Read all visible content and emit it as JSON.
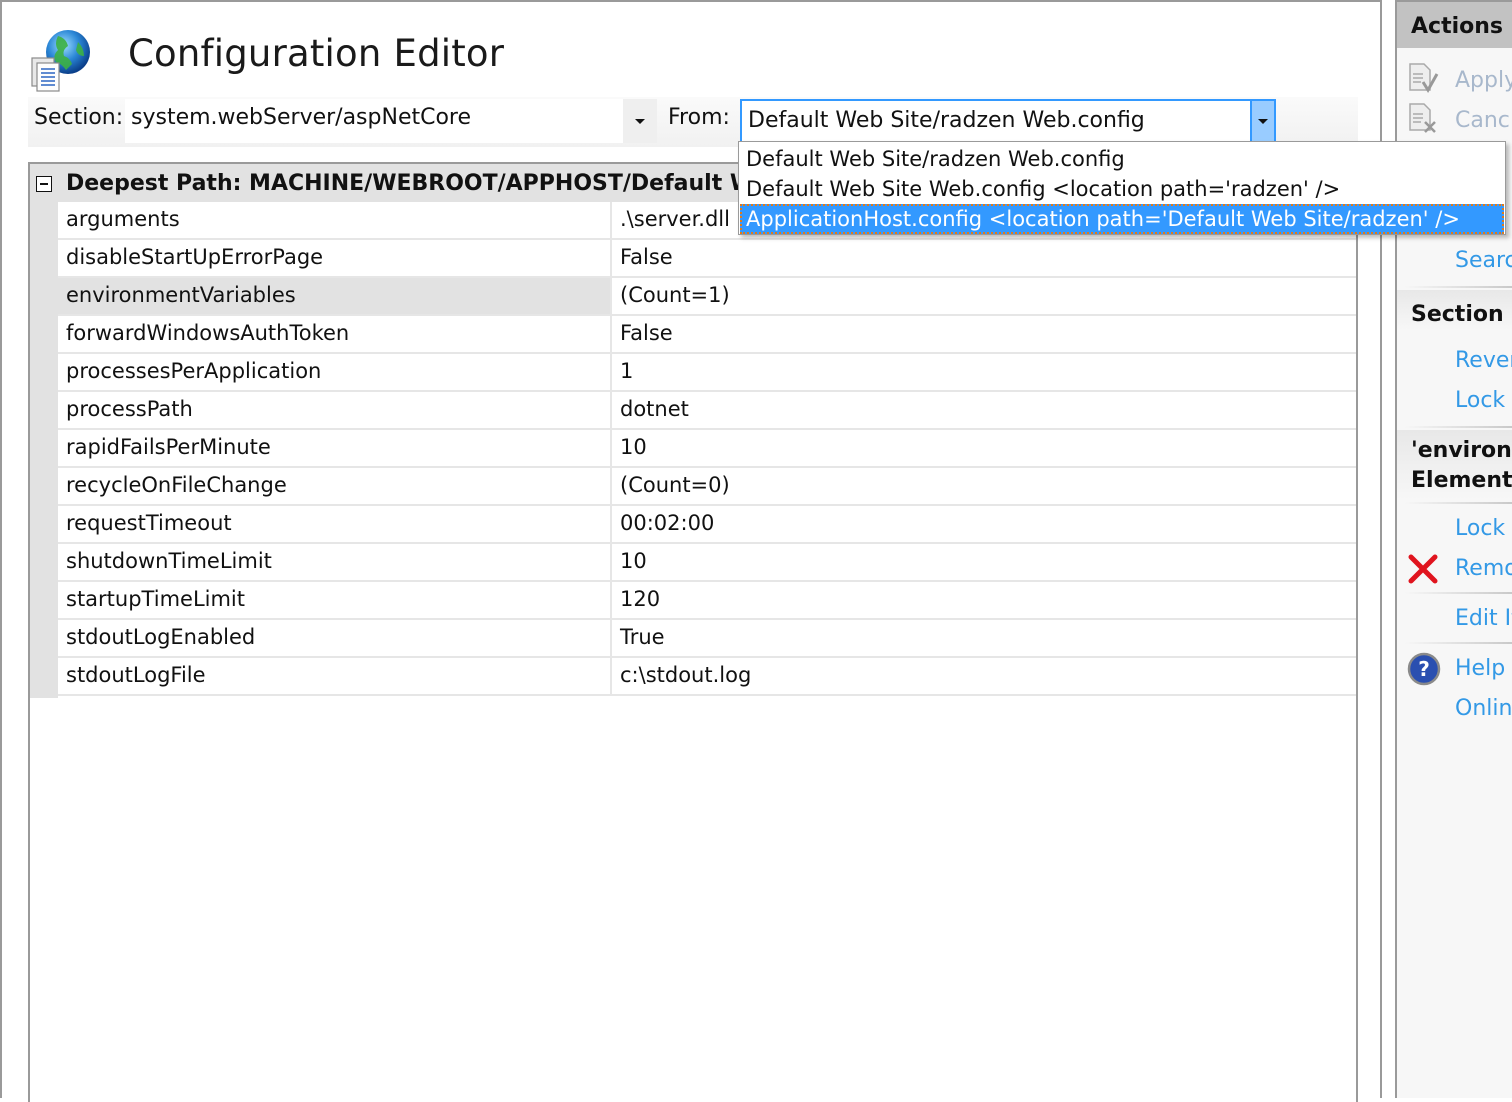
{
  "header": {
    "title": "Configuration Editor",
    "icon": "globe-document-icon"
  },
  "toolbar": {
    "section_label": "Section:",
    "section_value": "system.webServer/aspNetCore",
    "from_label": "From:",
    "from_value": "Default Web Site/radzen Web.config"
  },
  "from_dropdown": {
    "options": [
      "Default Web Site/radzen Web.config",
      "Default Web Site Web.config <location path='radzen' />",
      "ApplicationHost.config <location path='Default Web Site/radzen' />"
    ],
    "highlighted_index": 2
  },
  "grid": {
    "group_title": "Deepest Path: MACHINE/WEBROOT/APPHOST/Default Web",
    "rows": [
      {
        "name": "arguments",
        "value": ".\\server.dll"
      },
      {
        "name": "disableStartUpErrorPage",
        "value": "False"
      },
      {
        "name": "environmentVariables",
        "value": "(Count=1)",
        "selected": true
      },
      {
        "name": "forwardWindowsAuthToken",
        "value": "False"
      },
      {
        "name": "processesPerApplication",
        "value": "1"
      },
      {
        "name": "processPath",
        "value": "dotnet"
      },
      {
        "name": "rapidFailsPerMinute",
        "value": "10"
      },
      {
        "name": "recycleOnFileChange",
        "value": "(Count=0)"
      },
      {
        "name": "requestTimeout",
        "value": "00:02:00"
      },
      {
        "name": "shutdownTimeLimit",
        "value": "10"
      },
      {
        "name": "startupTimeLimit",
        "value": "120"
      },
      {
        "name": "stdoutLogEnabled",
        "value": "True"
      },
      {
        "name": "stdoutLogFile",
        "value": "c:\\stdout.log"
      }
    ]
  },
  "actions": {
    "title": "Actions",
    "apply": "Apply",
    "cancel": "Canc",
    "search": "Searc",
    "section_title": "Section",
    "revert": "Rever",
    "lock_section": "Lock",
    "element_title_line1": "'environn",
    "element_title_line2": "Element",
    "lock_element": "Lock",
    "remove": "Remo",
    "edit_items": "Edit It",
    "help": "Help",
    "online_help": "Onlin"
  }
}
